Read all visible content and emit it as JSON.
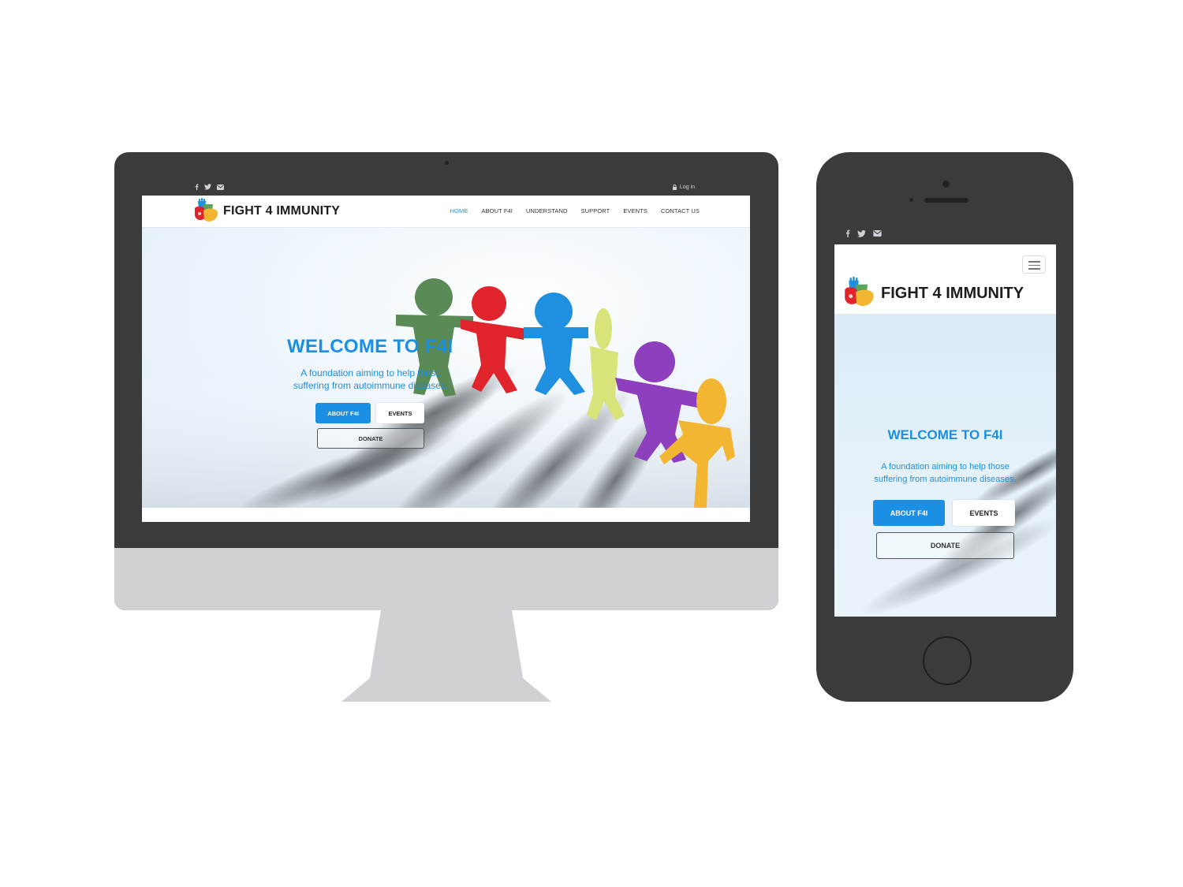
{
  "brand": {
    "name": "FIGHT 4 IMMUNITY"
  },
  "topbar": {
    "social_icons": [
      "facebook-icon",
      "twitter-icon",
      "envelope-icon"
    ],
    "login_label": "Log in"
  },
  "nav": {
    "items": [
      "HOME",
      "ABOUT F4I",
      "UNDERSTAND",
      "SUPPORT",
      "EVENTS",
      "CONTACT US"
    ],
    "active": "HOME"
  },
  "hero": {
    "title": "WELCOME TO F4I",
    "subtitle_line1": "A foundation aiming to help those",
    "subtitle_line2": "suffering from autoimmune diseases.",
    "about_button": "ABOUT F4I",
    "events_button": "EVENTS",
    "donate_button": "DONATE"
  },
  "mobile": {
    "hero_title": "WELCOME TO F4I",
    "about_button": "ABOUT F4I",
    "events_button": "EVENTS",
    "donate_button": "DONATE"
  },
  "colors": {
    "accent": "#1a8fe3",
    "device_frame": "#3b3b3b",
    "monitor_chin": "#d0d1d4",
    "figures": [
      "#5a8a55",
      "#e0242b",
      "#1f8fe0",
      "#d8e37a",
      "#8e3fbe",
      "#f2b632"
    ]
  }
}
